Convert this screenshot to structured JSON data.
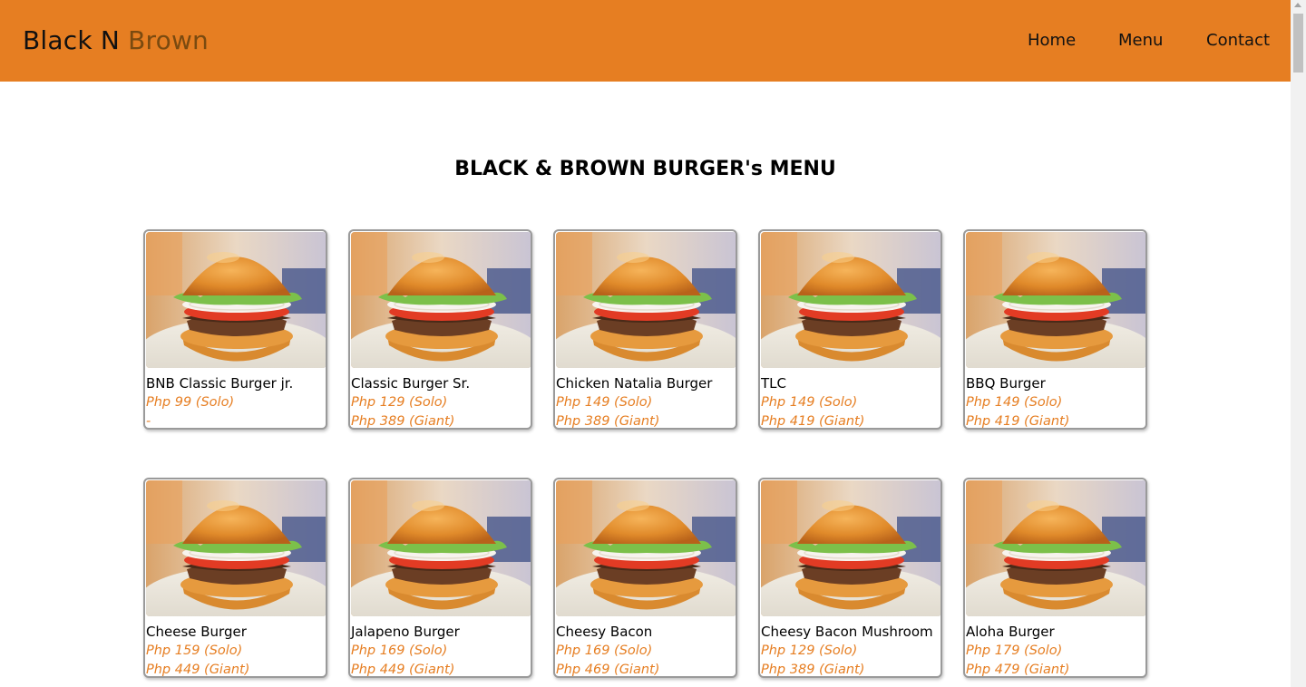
{
  "brand": {
    "part1": "Black N",
    "part2": "Brown"
  },
  "nav": {
    "home": "Home",
    "menu": "Menu",
    "contact": "Contact"
  },
  "menu_title": "BLACK & BROWN BURGER's MENU",
  "items": [
    {
      "name": "BNB Classic Burger jr.",
      "price1": "Php 99 (Solo)",
      "price2": "-"
    },
    {
      "name": "Classic Burger Sr.",
      "price1": "Php 129 (Solo)",
      "price2": "Php 389 (Giant)"
    },
    {
      "name": "Chicken Natalia Burger",
      "price1": "Php 149 (Solo)",
      "price2": "Php 389 (Giant)"
    },
    {
      "name": "TLC",
      "price1": "Php 149 (Solo)",
      "price2": "Php 419 (Giant)"
    },
    {
      "name": "BBQ Burger",
      "price1": "Php 149 (Solo)",
      "price2": "Php 419 (Giant)"
    },
    {
      "name": "Cheese Burger",
      "price1": "Php 159 (Solo)",
      "price2": "Php 449 (Giant)"
    },
    {
      "name": "Jalapeno Burger",
      "price1": "Php 169 (Solo)",
      "price2": "Php 449 (Giant)"
    },
    {
      "name": "Cheesy Bacon",
      "price1": "Php 169 (Solo)",
      "price2": "Php 469 (Giant)"
    },
    {
      "name": "Cheesy Bacon Mushroom",
      "price1": "Php 129 (Solo)",
      "price2": "Php 389 (Giant)"
    },
    {
      "name": "Aloha Burger",
      "price1": "Php 179 (Solo)",
      "price2": "Php 479 (Giant)"
    }
  ],
  "colors": {
    "header": "#e67e22",
    "price": "#e67e22",
    "brand_accent": "#7a4a10"
  }
}
